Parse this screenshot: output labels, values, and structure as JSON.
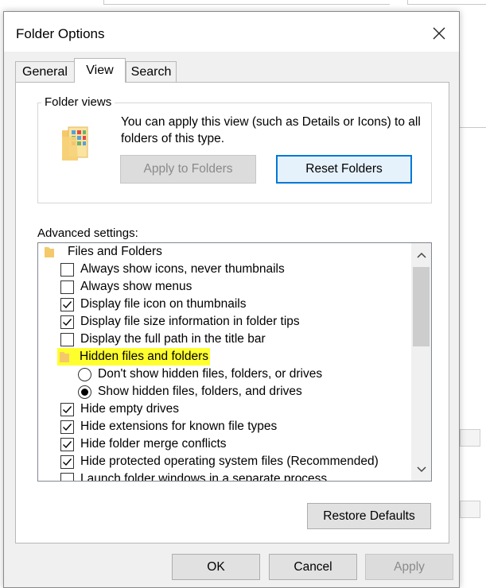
{
  "dialog": {
    "title": "Folder Options",
    "tabs": [
      {
        "label": "General",
        "active": false
      },
      {
        "label": "View",
        "active": true
      },
      {
        "label": "Search",
        "active": false
      }
    ]
  },
  "folder_views": {
    "label": "Folder views",
    "description": "You can apply this view (such as Details or Icons) to all folders of this type.",
    "apply_button": "Apply to Folders",
    "reset_button": "Reset Folders"
  },
  "advanced": {
    "label": "Advanced settings:",
    "items": [
      {
        "text": "Files and Folders",
        "kind": "folder"
      },
      {
        "text": "Always show icons, never thumbnails",
        "kind": "checkbox",
        "checked": false
      },
      {
        "text": "Always show menus",
        "kind": "checkbox",
        "checked": false
      },
      {
        "text": "Display file icon on thumbnails",
        "kind": "checkbox",
        "checked": true
      },
      {
        "text": "Display file size information in folder tips",
        "kind": "checkbox",
        "checked": true
      },
      {
        "text": "Display the full path in the title bar",
        "kind": "checkbox",
        "checked": false
      },
      {
        "text": "Hidden files and folders",
        "kind": "folder",
        "highlighted": true
      },
      {
        "text": "Don't show hidden files, folders, or drives",
        "kind": "radio",
        "checked": false
      },
      {
        "text": "Show hidden files, folders, and drives",
        "kind": "radio",
        "checked": true
      },
      {
        "text": "Hide empty drives",
        "kind": "checkbox",
        "checked": true
      },
      {
        "text": "Hide extensions for known file types",
        "kind": "checkbox",
        "checked": true
      },
      {
        "text": "Hide folder merge conflicts",
        "kind": "checkbox",
        "checked": true
      },
      {
        "text": "Hide protected operating system files (Recommended)",
        "kind": "checkbox",
        "checked": true
      },
      {
        "text": "Launch folder windows in a separate process",
        "kind": "checkbox",
        "checked": false
      }
    ]
  },
  "restore_button": "Restore Defaults",
  "footer": {
    "ok": "OK",
    "cancel": "Cancel",
    "apply": "Apply"
  },
  "colors": {
    "highlight": "#ffff2e",
    "accent": "#0078d7"
  }
}
